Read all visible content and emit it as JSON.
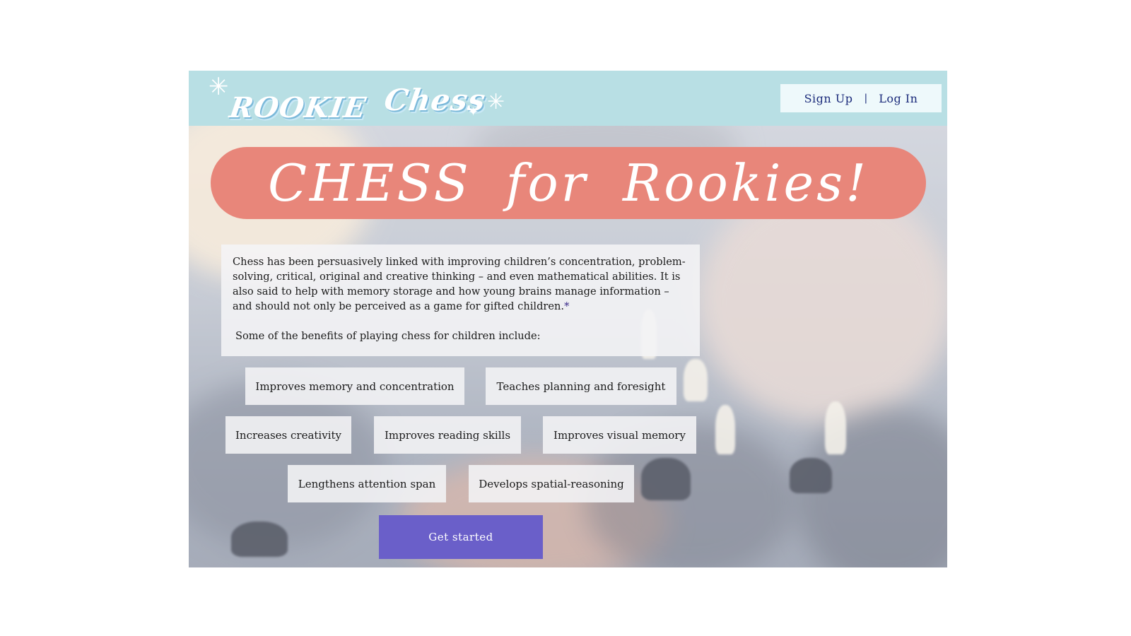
{
  "header": {
    "logo_word_1": "ROOKIE",
    "logo_word_2": "Chess",
    "sign_up_label": "Sign Up",
    "separator": "|",
    "log_in_label": "Log In"
  },
  "hero": {
    "title": "CHESS for Rookies!",
    "intro_text": "Chess has been persuasively linked with improving children’s concentration, problem-solving, critical, original and creative thinking – and even mathematical abilities. It is also said to help with memory storage and how young brains manage information – and should not only be perceived as a game for gifted children.",
    "intro_footnote_mark": "*",
    "benefits_heading": "Some of the benefits of playing chess for children include:",
    "benefits": [
      "Improves memory and concentration",
      "Teaches planning and foresight",
      "Increases creativity",
      "Improves reading skills",
      "Improves visual memory",
      "Lengthens attention span",
      "Develops spatial-reasoning"
    ],
    "cta_label": "Get started"
  },
  "colors": {
    "header_bg": "#b8dfe4",
    "title_pill": "#e8867a",
    "cta_bg": "#6a5fc9",
    "auth_text": "#1a2a7a"
  }
}
